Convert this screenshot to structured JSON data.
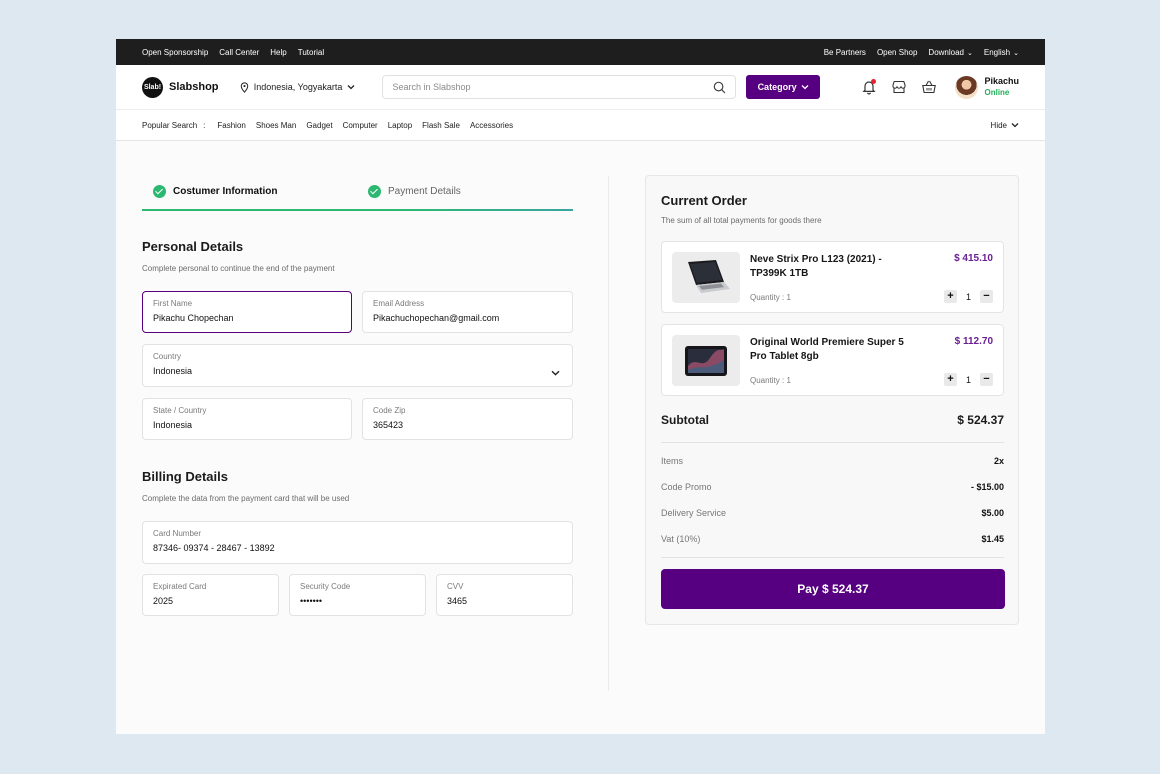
{
  "topbar": {
    "left": [
      "Open Sponsorship",
      "Call Center",
      "Help",
      "Tutorial"
    ],
    "right": [
      "Be Partners",
      "Open Shop",
      "Download",
      "English"
    ]
  },
  "header": {
    "logo_badge": "Slab!",
    "logo_name": "Slabshop",
    "location": "Indonesia, Yogyakarta",
    "search_placeholder": "Search in Slabshop",
    "category_label": "Category",
    "user_name": "Pikachu",
    "user_status": "Online"
  },
  "popular": {
    "label": "Popular Search",
    "separator": ":",
    "tags": [
      "Fashion",
      "Shoes Man",
      "Gadget",
      "Computer",
      "Laptop",
      "Flash Sale",
      "Accessories"
    ],
    "hide_label": "Hide"
  },
  "steps": {
    "step1": "Costumer Information",
    "step2": "Payment Details"
  },
  "personal": {
    "title": "Personal Details",
    "subtitle": "Complete personal to continue the end of the payment",
    "first_name_label": "First Name",
    "first_name_value": "Pikachu Chopechan",
    "email_label": "Email Address",
    "email_value": "Pikachuchopechan@gmail.com",
    "country_label": "Country",
    "country_value": "Indonesia",
    "state_label": "State / Country",
    "state_value": "Indonesia",
    "zip_label": "Code Zip",
    "zip_value": "365423"
  },
  "billing": {
    "title": "Billing Details",
    "subtitle": "Complete the data from the payment card that will be used",
    "card_label": "Card Number",
    "card_value": "87346- 09374 - 28467 - 13892",
    "expired_label": "Expirated Card",
    "expired_value": "2025",
    "security_label": "Security Code",
    "security_value": "•••••••",
    "cvv_label": "CVV",
    "cvv_value": "3465"
  },
  "order": {
    "title": "Current Order",
    "subtitle": "The sum of all total payments for goods there",
    "items": [
      {
        "name": "Neve Strix Pro L123 (2021) - TP399K 1TB",
        "price": "$ 415.10",
        "qty_label": "Quantity : 1",
        "qty": "1",
        "minus": "−",
        "plus": "+",
        "icon": "laptop-icon"
      },
      {
        "name": "Original World Premiere Super 5 Pro Tablet 8gb",
        "price": "$ 112.70",
        "qty_label": "Quantity : 1",
        "qty": "1",
        "minus": "−",
        "plus": "+",
        "icon": "tablet-icon"
      }
    ],
    "subtotal_label": "Subtotal",
    "subtotal_value": "$ 524.37",
    "rows": [
      {
        "k": "Items",
        "v": "2x"
      },
      {
        "k": "Code Promo",
        "v": "- $15.00"
      },
      {
        "k": "Delivery Service",
        "v": "$5.00"
      },
      {
        "k": "Vat (10%)",
        "v": "$1.45"
      }
    ],
    "pay_label": "Pay $ 524.37"
  },
  "colors": {
    "accent": "#560081",
    "success": "#2cb871",
    "price": "#6a1f93"
  }
}
